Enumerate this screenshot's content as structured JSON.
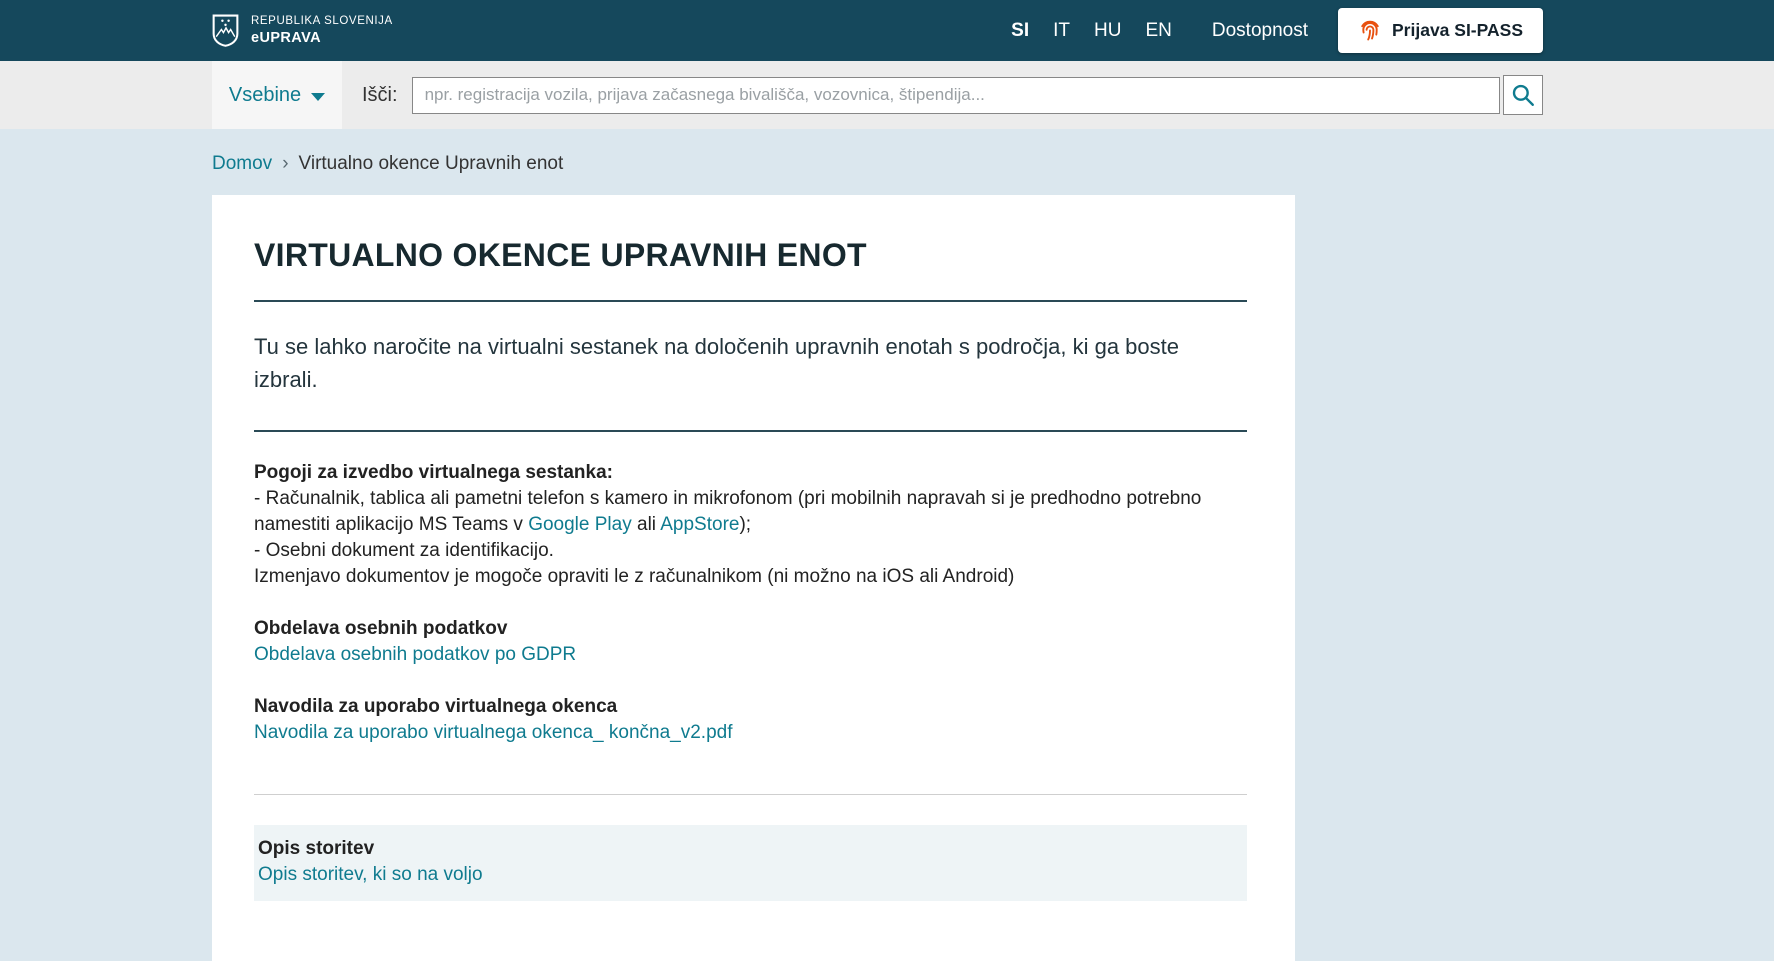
{
  "header": {
    "republic": "REPUBLIKA SLOVENIJA",
    "brand": "eUPRAVA",
    "languages": [
      {
        "label": "SI",
        "active": true
      },
      {
        "label": "IT",
        "active": false
      },
      {
        "label": "HU",
        "active": false
      },
      {
        "label": "EN",
        "active": false
      }
    ],
    "accessibility": "Dostopnost",
    "login": "Prijava SI-PASS"
  },
  "search": {
    "dropdown": "Vsebine",
    "label": "Išči:",
    "placeholder": "npr. registracija vozila, prijava začasnega bivališča, vozovnica, štipendija..."
  },
  "breadcrumb": {
    "home": "Domov",
    "separator": "›",
    "current": "Virtualno okence Upravnih enot"
  },
  "content": {
    "title": "VIRTUALNO OKENCE UPRAVNIH ENOT",
    "lead": "Tu se lahko naročite na virtualni sestanek na določenih upravnih enotah s področja, ki ga boste izbrali.",
    "conditions": {
      "heading": "Pogoji za izvedbo virtualnega sestanka:",
      "line1_prefix": "- Računalnik, tablica ali pametni telefon s kamero in mikrofonom (pri mobilnih napravah si je predhodno potrebno namestiti aplikacijo MS Teams v ",
      "google_play": "Google Play",
      "line1_mid": " ali ",
      "appstore": "AppStore",
      "line1_suffix": ");",
      "line2": "- Osebni dokument za identifikacijo.",
      "line3": "Izmenjavo dokumentov je mogoče opraviti le z računalnikom (ni možno na iOS ali Android)"
    },
    "gdpr": {
      "heading": "Obdelava osebnih podatkov",
      "link": "Obdelava osebnih podatkov po GDPR"
    },
    "instructions": {
      "heading": "Navodila za uporabo virtualnega okenca",
      "link": "Navodila za uporabo virtualnega okenca_ končna_v2.pdf"
    },
    "services": {
      "heading": "Opis storitev",
      "link": "Opis storitev, ki so na voljo"
    }
  },
  "colors": {
    "header_bg": "#15485c",
    "accent": "#0f7b8f",
    "page_bg": "#dbe7ee",
    "fingerprint": "#e8500f"
  }
}
